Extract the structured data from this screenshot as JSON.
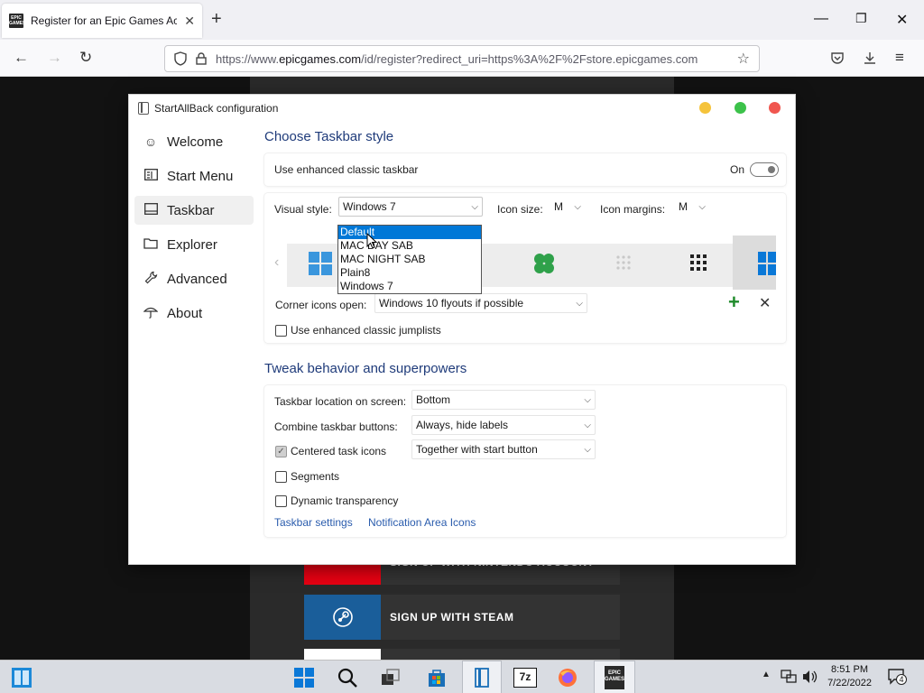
{
  "browser": {
    "tab_title": "Register for an Epic Games Acc",
    "url_prefix": "https://www.",
    "url_host": "epicgames.com",
    "url_rest": "/id/register?redirect_uri=https%3A%2F%2Fstore.epicgames.com",
    "favicon_text": "EPIC GAMES"
  },
  "page": {
    "signup_nintendo": "SIGN UP WITH NINTENDO ACCOUNT",
    "signup_steam": "SIGN UP WITH STEAM"
  },
  "window": {
    "title": "StartAllBack configuration",
    "dot_colors": [
      "#f5c33b",
      "#3cc24a",
      "#f0564f"
    ]
  },
  "sidebar": {
    "items": [
      {
        "label": "Welcome",
        "icon": "smile-icon"
      },
      {
        "label": "Start Menu",
        "icon": "start-menu-icon"
      },
      {
        "label": "Taskbar",
        "icon": "taskbar-icon"
      },
      {
        "label": "Explorer",
        "icon": "folder-icon"
      },
      {
        "label": "Advanced",
        "icon": "wrench-icon"
      },
      {
        "label": "About",
        "icon": "about-icon"
      }
    ]
  },
  "taskbar_section": {
    "title": "Choose Taskbar style",
    "enhanced_label": "Use enhanced classic taskbar",
    "enhanced_state": "On",
    "visual_style_label": "Visual style:",
    "visual_style_value": "Windows 7",
    "icon_size_label": "Icon size:",
    "icon_size_value": "M",
    "icon_margins_label": "Icon margins:",
    "icon_margins_value": "M",
    "style_options": [
      "Default",
      "MAC DAY SAB",
      "MAC NIGHT SAB",
      "Plain8",
      "Windows 7"
    ],
    "corner_label": "Corner icons open:",
    "corner_value": "Windows 10 flyouts if possible",
    "jumplists_label": "Use enhanced classic jumplists"
  },
  "behavior_section": {
    "title": "Tweak behavior and superpowers",
    "location_label": "Taskbar location on screen:",
    "location_value": "Bottom",
    "combine_label": "Combine taskbar buttons:",
    "combine_value": "Always, hide labels",
    "centered_label": "Centered task icons",
    "centered_value": "Together with start button",
    "segments_label": "Segments",
    "dynamic_label": "Dynamic transparency",
    "link_taskbar": "Taskbar settings",
    "link_notification": "Notification Area Icons"
  },
  "system_tray": {
    "time": "8:51 PM",
    "date": "7/22/2022",
    "notification_count": "4",
    "app_7z": "7z",
    "app_epic": "EPIC GAMES"
  }
}
